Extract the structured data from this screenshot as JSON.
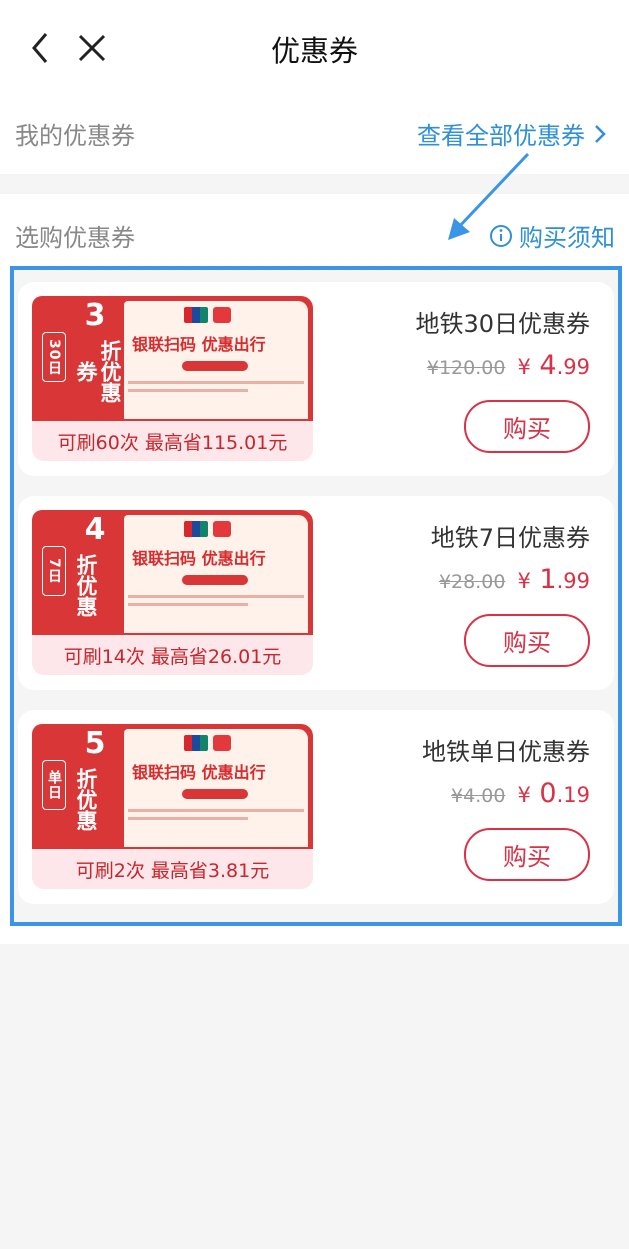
{
  "header": {
    "title": "优惠券",
    "back_icon": "chevron-left-icon",
    "close_icon": "close-icon"
  },
  "my_coupons": {
    "label": "我的优惠券",
    "view_all": "查看全部优惠券"
  },
  "shop": {
    "label": "选购优惠券",
    "notice": "购买须知"
  },
  "coupons": [
    {
      "title": "地铁30日优惠券",
      "old_price": "¥120.00",
      "new_price_symbol": "¥",
      "new_price_int": "4",
      "new_price_dec": ".99",
      "buy_label": "购买",
      "discount_num": "3",
      "discount_text": "折优惠券",
      "duration": "30日",
      "slogan": "银联扫码 优惠出行",
      "caption": "可刷60次 最高省115.01元"
    },
    {
      "title": "地铁7日优惠券",
      "old_price": "¥28.00",
      "new_price_symbol": "¥",
      "new_price_int": "1",
      "new_price_dec": ".99",
      "buy_label": "购买",
      "discount_num": "4",
      "discount_text": "折优惠",
      "duration": "7日",
      "slogan": "银联扫码 优惠出行",
      "caption": "可刷14次 最高省26.01元"
    },
    {
      "title": "地铁单日优惠券",
      "old_price": "¥4.00",
      "new_price_symbol": "¥",
      "new_price_int": "0",
      "new_price_dec": ".19",
      "buy_label": "购买",
      "discount_num": "5",
      "discount_text": "折优惠",
      "duration": "单日",
      "slogan": "银联扫码 优惠出行",
      "caption": "可刷2次 最高省3.81元"
    }
  ],
  "colors": {
    "accent_blue": "#2f8fd8",
    "highlight_blue": "#3a95e6",
    "price_red": "#d93145",
    "ticket_red": "#d93638"
  }
}
